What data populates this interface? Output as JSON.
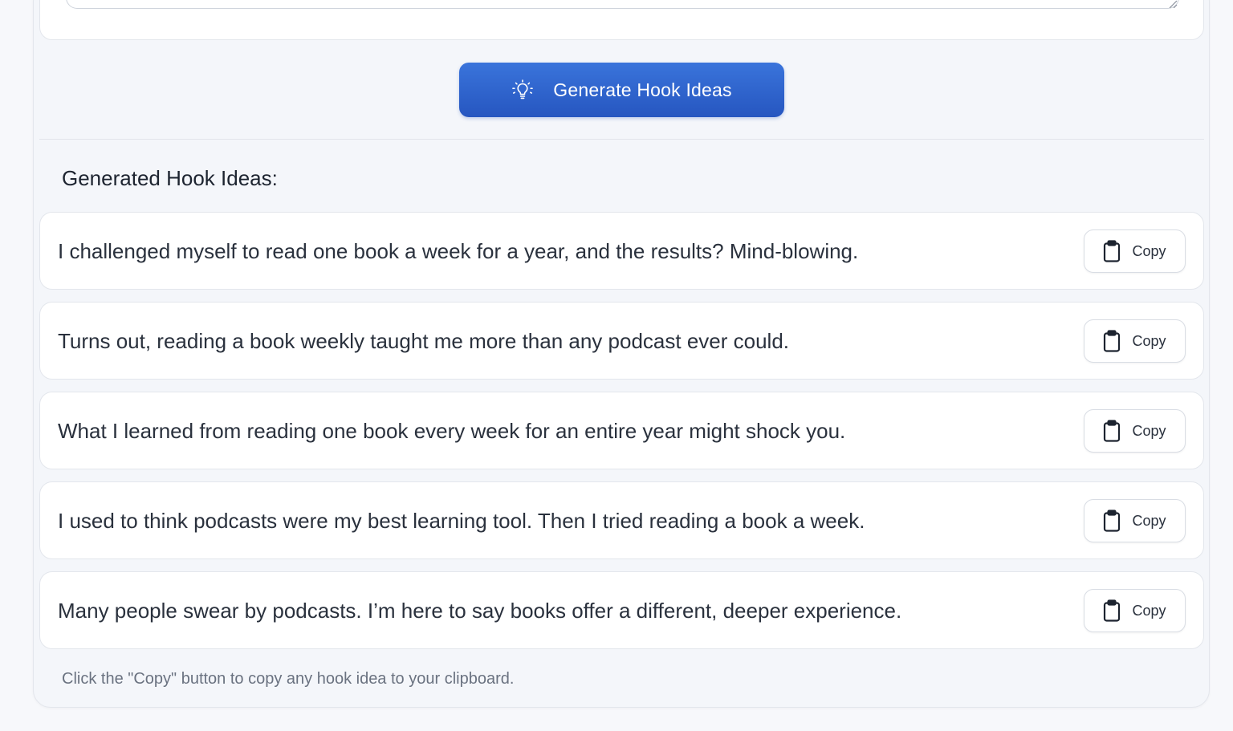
{
  "generate": {
    "label": "Generate Hook Ideas",
    "icon": "lightbulb-icon"
  },
  "results": {
    "title": "Generated Hook Ideas:",
    "copy_label": "Copy",
    "copy_icon": "clipboard-icon",
    "hooks": [
      "I challenged myself to read one book a week for a year, and the results? Mind-blowing.",
      "Turns out, reading a book weekly taught me more than any podcast ever could.",
      "What I learned from reading one book every week for an entire year might shock you.",
      "I used to think podcasts were my best learning tool. Then I tried reading a book a week.",
      "Many people swear by podcasts. I’m here to say books offer a different, deeper experience."
    ]
  },
  "footer": {
    "note": "Click the \"Copy\" button to copy any hook idea to your clipboard."
  },
  "colors": {
    "accent": "#2f63cc",
    "text": "#2a313d",
    "muted": "#6a7280"
  }
}
